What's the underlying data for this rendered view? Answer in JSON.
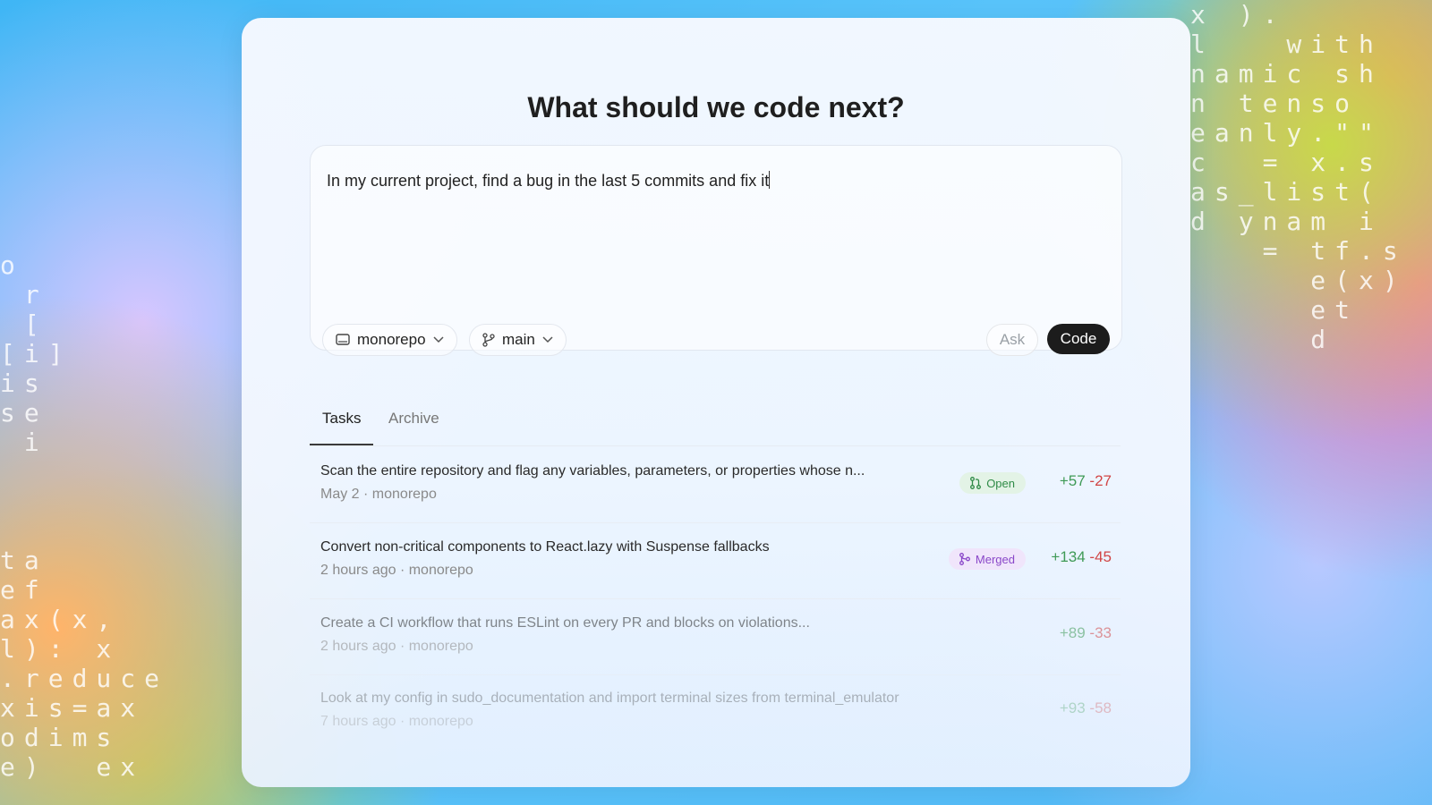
{
  "background": {
    "code_rain_right": [
      "x ).",
      "l   with",
      "namic sh",
      "n tenso",
      "eanly.\"\"",
      "c  = x.s",
      "as_list(",
      "d ynam i",
      "   = tf.s",
      "     e(x)",
      "     et",
      "     d"
    ],
    "code_rain_left": [
      "o",
      " r",
      " [",
      "[i]",
      "is",
      "se",
      " i",
      "",
      "",
      "",
      "ta",
      "ef",
      "ax(x,",
      "l): x",
      ".reduce",
      "xis=ax",
      "odims",
      "e)  ex"
    ]
  },
  "header": {
    "title": "What should we code next?"
  },
  "prompt": {
    "text": "In my current project, find a bug in the last 5 commits and fix it",
    "repo": "monorepo",
    "branch": "main",
    "ask_label": "Ask",
    "code_label": "Code"
  },
  "tabs": {
    "tasks": "Tasks",
    "archive": "Archive"
  },
  "tasks": [
    {
      "title": "Scan the entire repository and flag any variables, parameters, or properties whose n...",
      "meta": "May 2 · monorepo",
      "status": "Open",
      "added": "+57",
      "removed": "-27"
    },
    {
      "title": "Convert non-critical components to React.lazy with Suspense fallbacks",
      "meta": "2 hours ago · monorepo",
      "status": "Merged",
      "added": "+134",
      "removed": "-45"
    },
    {
      "title": "Create a CI workflow that runs ESLint on every PR and blocks on violations...",
      "meta": "2 hours ago · monorepo",
      "status": "",
      "added": "+89",
      "removed": "-33"
    },
    {
      "title": "Look at my config in sudo_documentation and import terminal sizes from terminal_emulator",
      "meta": "7 hours ago · monorepo",
      "status": "",
      "added": "+93",
      "removed": "-58"
    }
  ],
  "colors": {
    "accent": "#1c1c1c",
    "added": "#3f9a56",
    "removed": "#d14545",
    "open_badge": "#2f8b47",
    "merged_badge": "#8a47c9"
  },
  "icons": [
    "monitor-icon",
    "chevron-down-icon",
    "git-branch-icon",
    "git-pull-request-icon",
    "git-merge-icon"
  ]
}
